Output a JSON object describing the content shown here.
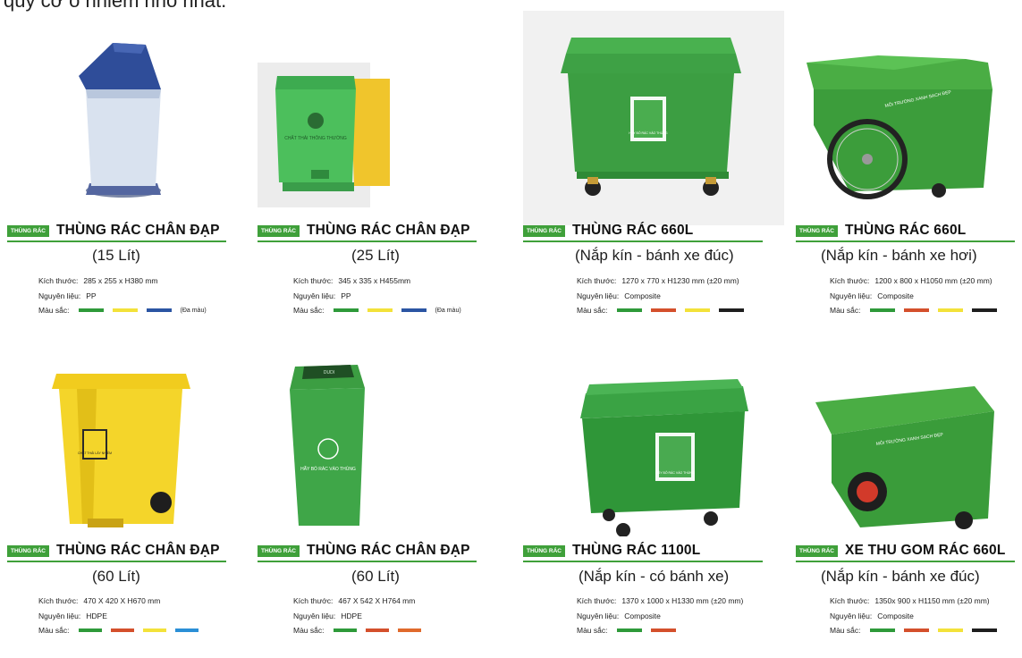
{
  "header": {
    "partial_text": "quy cơ ô nhiễm nhỏ nhất."
  },
  "tag_label": "THÙNG RÁC",
  "spec_labels": {
    "size": "Kích thước:",
    "material": "Nguyên liệu:",
    "color": "Màu sắc:"
  },
  "colors": {
    "green": "#2e9a3a",
    "yellow": "#f3e23a",
    "blue": "#2b55a3",
    "red": "#d4502c",
    "black": "#1e1e1e",
    "orange": "#e06a2c",
    "lightblue": "#2b8fd6"
  },
  "products": [
    {
      "title": "THÙNG RÁC CHÂN ĐẠP",
      "subtitle": "(15 Lít)",
      "size": "285 x 255 x H380 mm",
      "material": "PP",
      "colors": [
        "green",
        "yellow",
        "blue"
      ],
      "note": "(Đa màu)"
    },
    {
      "title": "THÙNG RÁC CHÂN ĐẠP",
      "subtitle": "(25 Lít)",
      "size": "345 x 335 x H455mm",
      "material": "PP",
      "colors": [
        "green",
        "yellow",
        "blue"
      ],
      "note": "(Đa màu)"
    },
    {
      "title": "THÙNG RÁC 660L",
      "subtitle": "(Nắp kín - bánh xe đúc)",
      "size": "1270 x 770 x H1230 mm (±20 mm)",
      "material": "Composite",
      "colors": [
        "green",
        "red",
        "yellow",
        "black"
      ],
      "note": ""
    },
    {
      "title": "THÙNG RÁC 660L",
      "subtitle": "(Nắp kín - bánh xe hơi)",
      "size": "1200 x 800 x H1050 mm (±20 mm)",
      "material": "Composite",
      "colors": [
        "green",
        "red",
        "yellow",
        "black"
      ],
      "note": ""
    },
    {
      "title": "THÙNG RÁC CHÂN ĐẠP",
      "subtitle": "(60 Lít)",
      "size": "470 X 420 X H670 mm",
      "material": "HDPE",
      "colors": [
        "green",
        "red",
        "yellow",
        "lightblue"
      ],
      "note": ""
    },
    {
      "title": "THÙNG RÁC CHÂN ĐẠP",
      "subtitle": "(60 Lít)",
      "size": "467 X 542 X H764 mm",
      "material": "HDPE",
      "colors": [
        "green",
        "red",
        "orange"
      ],
      "note": ""
    },
    {
      "title": "THÙNG RÁC 1100L",
      "subtitle": "(Nắp kín - có  bánh xe)",
      "size": "1370 x 1000 x H1330 mm (±20 mm)",
      "material": "Composite",
      "colors": [
        "green",
        "red"
      ],
      "note": ""
    },
    {
      "title": "XE THU GOM RÁC 660L",
      "subtitle": "(Nắp kín - bánh xe đúc)",
      "size": "1350x 900 x H1150 mm (±20 mm)",
      "material": "Composite",
      "colors": [
        "green",
        "red",
        "yellow",
        "black"
      ],
      "note": ""
    }
  ],
  "image_texts": {
    "bin25_label": "CHẤT THẢI THÔNG THƯỜNG",
    "bin660_label": "HÃY BỎ RÁC VÀO THÙNG",
    "cart_side": "MÔI TRƯỜNG XANH SẠCH ĐẸP",
    "yellow_bin_label": "CHẤT THẢI LÂY NHIỄM",
    "swing_bin_label": "HÃY BỎ RÁC VÀO THÙNG",
    "swing_bin_brand": "DUDI",
    "bin1100_label": "HÃY BỎ RÁC VÀO THÙNG",
    "cart2_side": "MÔI TRƯỜNG XANH SẠCH ĐẸP"
  }
}
